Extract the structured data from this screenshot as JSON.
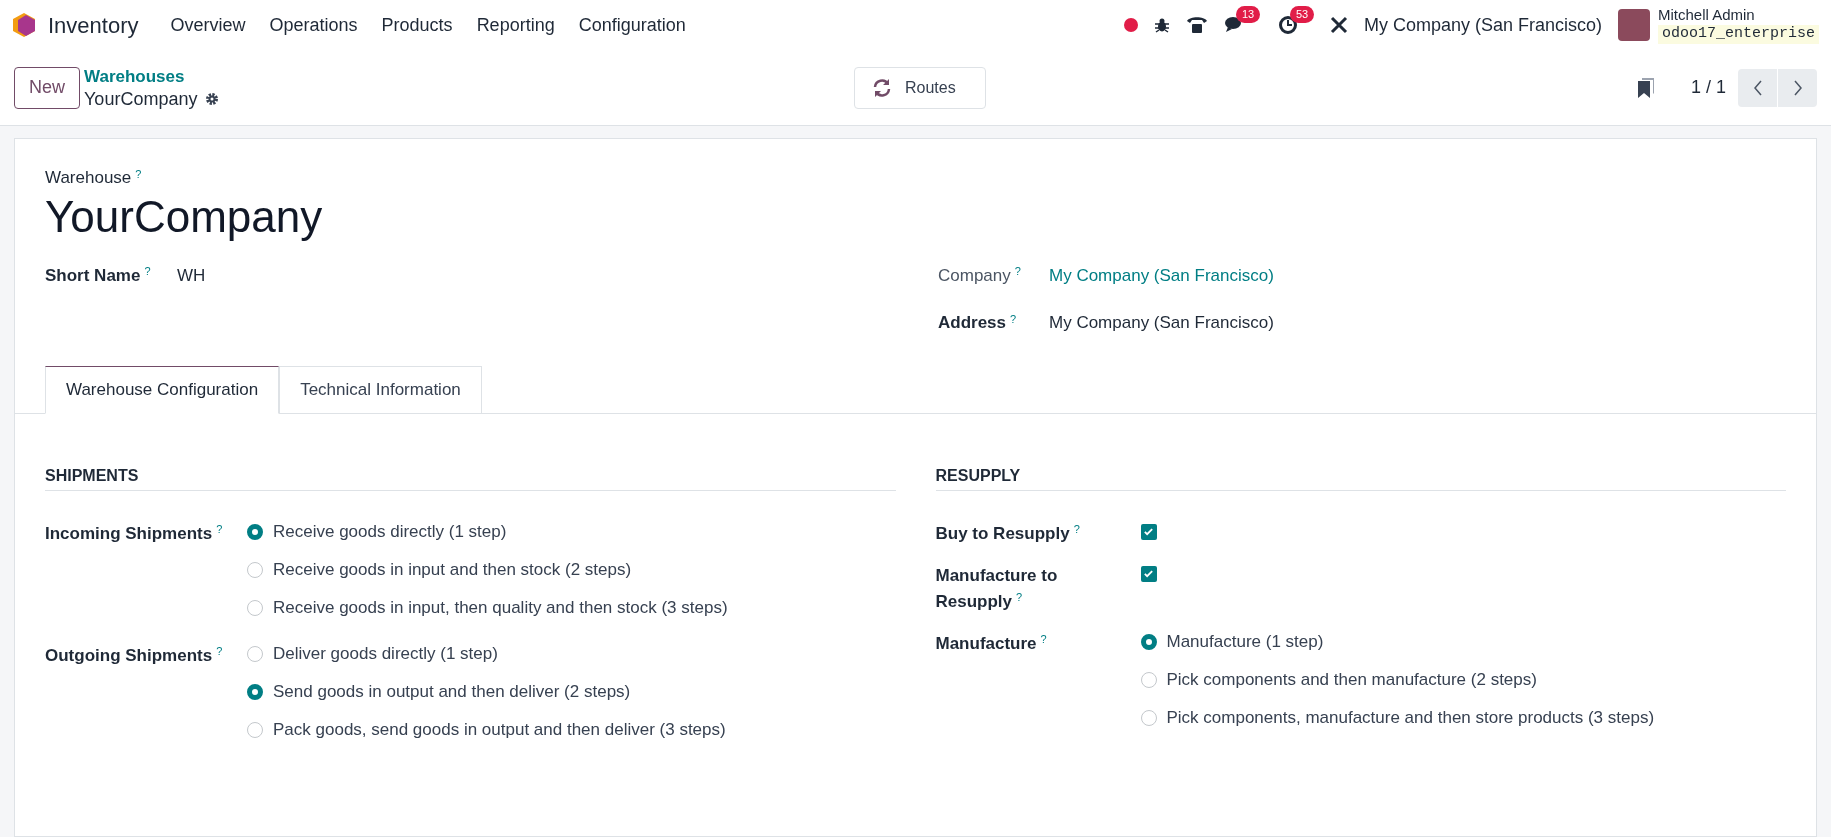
{
  "navbar": {
    "app": "Inventory",
    "menu": [
      "Overview",
      "Operations",
      "Products",
      "Reporting",
      "Configuration"
    ],
    "badges": [
      {
        "kind": "chat",
        "count": "13"
      },
      {
        "kind": "activity",
        "count": "53"
      }
    ],
    "company": "My Company (San Francisco)",
    "user": "Mitchell Admin",
    "database": "odoo17_enterprise"
  },
  "control_panel": {
    "new_button": "New",
    "breadcrumb": "Warehouses",
    "record": "YourCompany",
    "routes_button": "Routes",
    "pager": "1 / 1"
  },
  "form": {
    "title_label": "Warehouse",
    "title_help": "?",
    "title": "YourCompany",
    "left_fields": [
      {
        "label": "Short Name",
        "help": "?",
        "value": "WH"
      }
    ],
    "right_fields": [
      {
        "label": "Company",
        "help": "?",
        "value": "My Company (San Francisco)",
        "kind": "link"
      },
      {
        "label": "Address",
        "help": "?",
        "value": "My Company (San Francisco)",
        "kind": "text"
      }
    ],
    "tabs": [
      {
        "label": "Warehouse Configuration",
        "selected": true
      },
      {
        "label": "Technical Information",
        "selected": false
      }
    ],
    "sections": [
      {
        "title": "SHIPMENTS",
        "fields": [
          {
            "label": "Incoming Shipments",
            "help": "?",
            "kind": "radio",
            "options": [
              {
                "label": "Receive goods directly (1 step)",
                "selected": true
              },
              {
                "label": "Receive goods in input and then stock (2 steps)",
                "selected": false
              },
              {
                "label": "Receive goods in input, then quality and then stock (3 steps)",
                "selected": false
              }
            ]
          },
          {
            "label": "Outgoing Shipments",
            "help": "?",
            "kind": "radio",
            "options": [
              {
                "label": "Deliver goods directly (1 step)",
                "selected": false
              },
              {
                "label": "Send goods in output and then deliver (2 steps)",
                "selected": true
              },
              {
                "label": "Pack goods, send goods in output and then deliver (3 steps)",
                "selected": false
              }
            ]
          }
        ]
      },
      {
        "title": "RESUPPLY",
        "fields": [
          {
            "label": "Buy to Resupply",
            "help": "?",
            "kind": "checkbox",
            "checked": true
          },
          {
            "label": "Manufacture to Resupply",
            "help": "?",
            "kind": "checkbox",
            "checked": true
          },
          {
            "label": "Manufacture",
            "help": "?",
            "kind": "radio",
            "options": [
              {
                "label": "Manufacture (1 step)",
                "selected": true
              },
              {
                "label": "Pick components and then manufacture (2 steps)",
                "selected": false
              },
              {
                "label": "Pick components, manufacture and then store products (3 steps)",
                "selected": false
              }
            ]
          }
        ]
      }
    ]
  }
}
